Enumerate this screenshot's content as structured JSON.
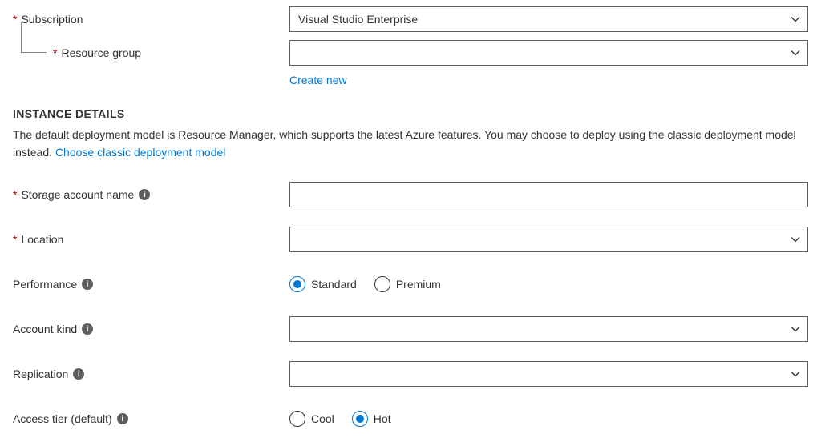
{
  "project": {
    "subscription": {
      "label": "Subscription",
      "value": "Visual Studio Enterprise"
    },
    "resourceGroup": {
      "label": "Resource group",
      "value": "",
      "createNew": "Create new"
    }
  },
  "instanceDetails": {
    "header": "INSTANCE DETAILS",
    "descPrefix": "The default deployment model is Resource Manager, which supports the latest Azure features. You may choose to deploy using the classic deployment model instead.  ",
    "classicLink": "Choose classic deployment model",
    "storageAccountName": {
      "label": "Storage account name",
      "value": ""
    },
    "location": {
      "label": "Location",
      "value": ""
    },
    "performance": {
      "label": "Performance",
      "options": {
        "standard": "Standard",
        "premium": "Premium"
      },
      "selected": "standard"
    },
    "accountKind": {
      "label": "Account kind",
      "value": ""
    },
    "replication": {
      "label": "Replication",
      "value": ""
    },
    "accessTier": {
      "label": "Access tier (default)",
      "options": {
        "cool": "Cool",
        "hot": "Hot"
      },
      "selected": "hot"
    }
  }
}
